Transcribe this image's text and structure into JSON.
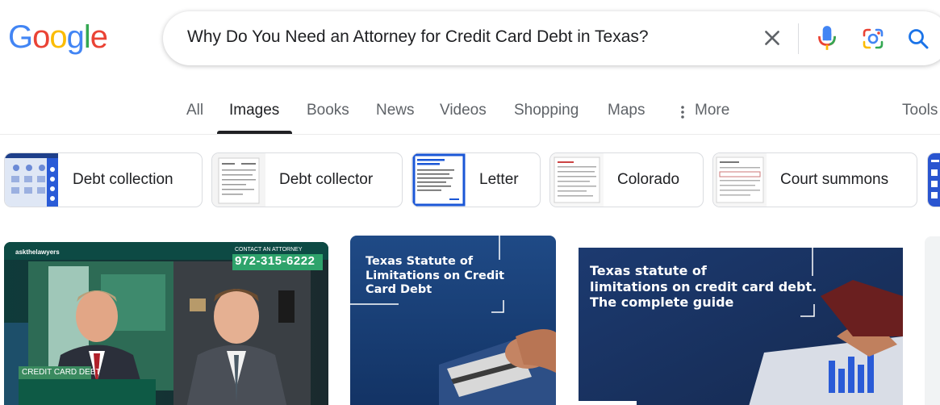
{
  "logo": {
    "letters": [
      "G",
      "o",
      "o",
      "g",
      "l",
      "e"
    ],
    "colors": [
      "#4285F4",
      "#EA4335",
      "#FBBC05",
      "#4285F4",
      "#34A853",
      "#EA4335"
    ]
  },
  "search": {
    "query": "Why Do You Need an Attorney for Credit Card Debt in Texas?"
  },
  "tabs": {
    "all": "All",
    "images": "Images",
    "books": "Books",
    "news": "News",
    "videos": "Videos",
    "shopping": "Shopping",
    "maps": "Maps",
    "more": "More",
    "tools": "Tools"
  },
  "chips": [
    {
      "label": "Debt collection"
    },
    {
      "label": "Debt collector"
    },
    {
      "label": "Letter"
    },
    {
      "label": "Colorado"
    },
    {
      "label": "Court summons"
    }
  ],
  "results": [
    {
      "brand": "askthelawyers",
      "contact_label": "CONTACT AN ATTORNEY",
      "phone": "972-315-6222",
      "lower_third": "CREDIT CARD DEBT"
    },
    {
      "line1": "Texas Statute of",
      "line2": "Limitations on Credit",
      "line3": "Card Debt"
    },
    {
      "line1": "Texas statute of",
      "line2": "limitations on credit card debt.",
      "line3": "The complete guide"
    }
  ],
  "colors": {
    "accent_blue": "#1a73e8",
    "text_primary": "#202124",
    "text_secondary": "#5f6368",
    "phone_green": "#2ea36b"
  }
}
